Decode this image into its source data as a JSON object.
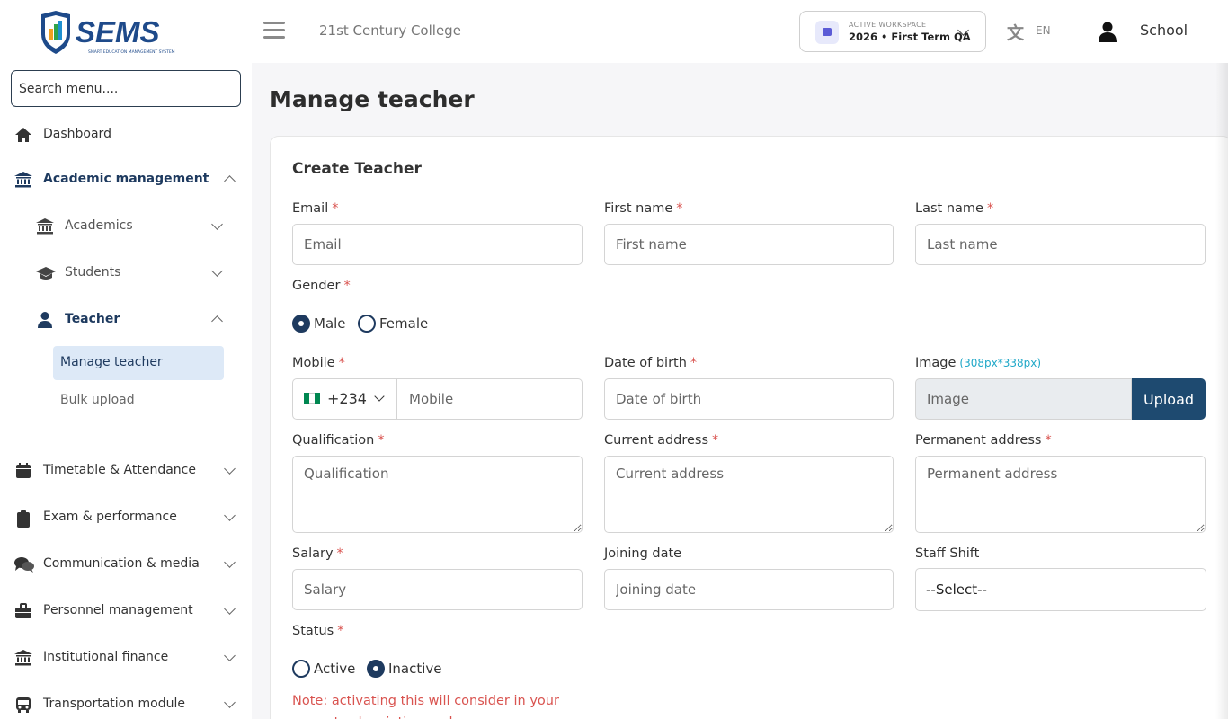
{
  "header": {
    "logo_text": "SEMS",
    "logo_tagline": "SMART EDUCATION MANAGEMENT SYSTEM",
    "college_name": "21st Century College",
    "workspace_caption": "ACTIVE WORKSPACE",
    "workspace_value": "2026 • First Term QA",
    "language": "EN",
    "user_name": "School"
  },
  "sidebar": {
    "search_placeholder": "Search menu....",
    "items": [
      {
        "label": "Dashboard",
        "icon": "home-icon"
      },
      {
        "label": "Academic management",
        "icon": "institution-icon",
        "expanded": true
      },
      {
        "label": "Academics",
        "icon": "institution-icon"
      },
      {
        "label": "Students",
        "icon": "graduation-cap-icon"
      },
      {
        "label": "Teacher",
        "icon": "user-icon",
        "expanded": true
      },
      {
        "label": "Manage teacher",
        "active": true
      },
      {
        "label": "Bulk upload"
      },
      {
        "label": "Timetable & Attendance",
        "icon": "calendar-icon"
      },
      {
        "label": "Exam & performance",
        "icon": "clipboard-icon"
      },
      {
        "label": "Communication & media",
        "icon": "comments-icon"
      },
      {
        "label": "Personnel management",
        "icon": "briefcase-icon"
      },
      {
        "label": "Institutional finance",
        "icon": "institution-icon"
      },
      {
        "label": "Transportation module",
        "icon": "bus-icon"
      }
    ]
  },
  "page": {
    "title": "Manage teacher",
    "card_title": "Create Teacher"
  },
  "form": {
    "required_mark": "*",
    "email": {
      "label": "Email",
      "placeholder": "Email"
    },
    "first_name": {
      "label": "First name",
      "placeholder": "First name"
    },
    "last_name": {
      "label": "Last name",
      "placeholder": "Last name"
    },
    "gender": {
      "label": "Gender",
      "options": [
        "Male",
        "Female"
      ],
      "selected": "Male"
    },
    "mobile": {
      "label": "Mobile",
      "country_code": "+234",
      "placeholder": "Mobile"
    },
    "dob": {
      "label": "Date of birth",
      "placeholder": "Date of birth"
    },
    "image": {
      "label": "Image",
      "hint": "(308px*338px)",
      "placeholder": "Image",
      "button": "Upload"
    },
    "qualification": {
      "label": "Qualification",
      "placeholder": "Qualification"
    },
    "current_address": {
      "label": "Current address",
      "placeholder": "Current address"
    },
    "permanent_address": {
      "label": "Permanent address",
      "placeholder": "Permanent address"
    },
    "salary": {
      "label": "Salary",
      "placeholder": "Salary"
    },
    "joining_date": {
      "label": "Joining date",
      "placeholder": "Joining date"
    },
    "staff_shift": {
      "label": "Staff Shift",
      "value": "--Select--"
    },
    "status": {
      "label": "Status",
      "options": [
        "Active",
        "Inactive"
      ],
      "selected": "Inactive"
    },
    "note": "Note: activating this will consider in your current subscription cycle"
  },
  "colors": {
    "brand": "#1e3a5f",
    "accent_blue": "#1e4a70",
    "required": "#d9534f",
    "hint": "#20a8c8",
    "active_bg": "#dde9f7"
  }
}
